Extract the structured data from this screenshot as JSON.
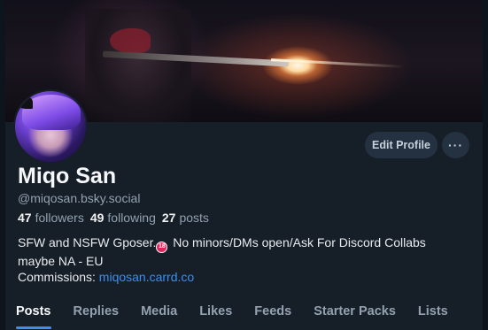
{
  "profile": {
    "display_name": "Miqo San",
    "handle": "@miqosan.bsky.social"
  },
  "stats": {
    "followers_count": "47",
    "followers_label": "followers",
    "following_count": "49",
    "following_label": "following",
    "posts_count": "27",
    "posts_label": "posts"
  },
  "actions": {
    "edit_label": "Edit Profile",
    "more_label": "···"
  },
  "bio": {
    "line1_a": "SFW and NSFW Gposer.",
    "nsfw_badge": "18",
    "line1_b": " No minors/DMs open/Ask For Discord Collabs",
    "line2": "maybe NA - EU",
    "commissions_label": "Commissions: ",
    "commissions_link": "miqosan.carrd.co"
  },
  "tabs": [
    {
      "label": "Posts",
      "active": true
    },
    {
      "label": "Replies"
    },
    {
      "label": "Media"
    },
    {
      "label": "Likes"
    },
    {
      "label": "Feeds"
    },
    {
      "label": "Starter Packs"
    },
    {
      "label": "Lists"
    }
  ],
  "colors": {
    "background": "#161e27",
    "accent": "#3b8ff0",
    "muted_text": "#93a1b0",
    "button_bg": "#243140"
  }
}
